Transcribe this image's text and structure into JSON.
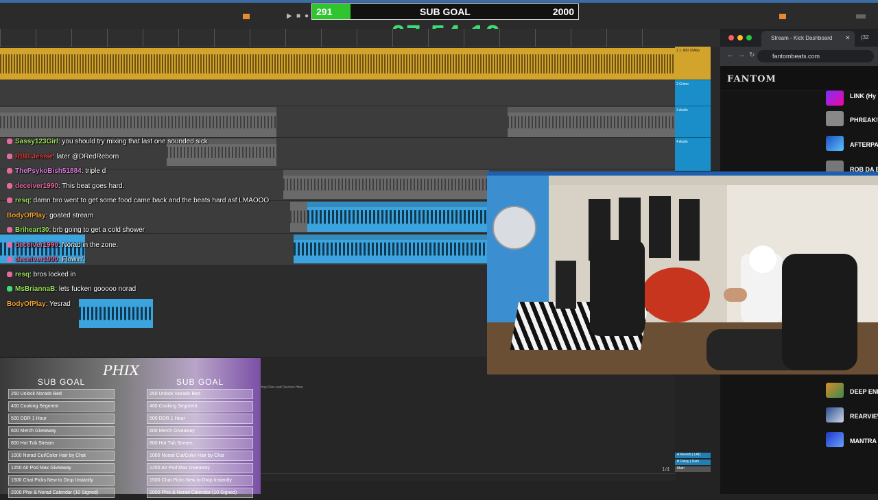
{
  "overlay": {
    "sub_goal": {
      "current": "291",
      "title": "SUB GOAL",
      "target": "2000",
      "progress": 0.1455
    },
    "timer": "07:54:19"
  },
  "colors": {
    "timer": "#3fdc74",
    "goal_fill": "#2fc52f",
    "clip_yellow": "#d3a42b",
    "clip_blue": "#3ba3de"
  },
  "daw": {
    "track_headers": [
      "1 1. 800 16Abp",
      "2 Grimo",
      "3 Audio",
      "4 Audio"
    ],
    "drop_text": "Drop Files and Devices Here",
    "return_tracks": [
      "A Reverb | LAD",
      "B Delay | Dark",
      "Main"
    ],
    "page_indicator": "1/4"
  },
  "chat": [
    {
      "user": "Sassy123Girl",
      "color": "#9be15d",
      "text": ": you should try mixing that last one sounded sick",
      "badge": "#e66aa0"
    },
    {
      "user": "RBB.Jessie",
      "color": "#e0403f",
      "text": ": later @DRedReborn",
      "badge": "#e66aa0"
    },
    {
      "user": "ThePsykoBish51884",
      "color": "#d67ad6",
      "text": ": triple d",
      "badge": "#e66aa0"
    },
    {
      "user": "deceiver1990",
      "color": "#e66aa0",
      "text": ": This beat goes hard.",
      "badge": "#e66aa0"
    },
    {
      "user": "resq",
      "color": "#9be15d",
      "text": ": damn bro went to get some food came back and the beats hard asf LMAOOO",
      "badge": "#e66aa0"
    },
    {
      "user": "BodyOfPlay",
      "color": "#f0a437",
      "text": ": goated stream",
      "badge": ""
    },
    {
      "user": "Briheart30",
      "color": "#9be15d",
      "text": ": brb going to get a cold shower",
      "badge": "#e66aa0"
    },
    {
      "user": "deceiver1990",
      "color": "#e66aa0",
      "text": ": Norad in the zone.",
      "badge": "#e66aa0"
    },
    {
      "user": "deceiver1990",
      "color": "#e66aa0",
      "text": ": Flowin'.",
      "badge": "#e66aa0"
    },
    {
      "user": "resq",
      "color": "#9be15d",
      "text": ": bros locked in",
      "badge": "#e66aa0"
    },
    {
      "user": "MsBriannaB",
      "color": "#9be15d",
      "text": ": lets fucken gooooo norad",
      "badge": "#3fdc74"
    },
    {
      "user": "BodyOfPlay",
      "color": "#f0a437",
      "text": ": Yesrad",
      "badge": ""
    }
  ],
  "sub_goals": {
    "logo": "PHIX",
    "heading": "SUB GOAL",
    "items": [
      "250 Unlock Norads Bed",
      "400 Cooking Segment",
      "500 DDR 1 Hour",
      "600 Merch Giveaway",
      "800 Hot Tub Stream",
      "1000 Norad Cut/Color Hair by Chat",
      "1250 Air Pod Max Giveaway",
      "1500 Chat Picks New to Drop Instantly",
      "2000 Phix & Norad Calendar (10 Signed)"
    ]
  },
  "browser": {
    "tab_title": "Stream - Kick Dashboard",
    "tab2": "(32",
    "url": "fantombeats.com",
    "site_logo": "FANTOM",
    "tracks_top": [
      "LINK (Hy",
      "PHREAK!",
      "AFTERPA",
      "ROB DA B"
    ],
    "tracks_bottom": [
      "DEEP END",
      "REARVIEW",
      "MANTRA"
    ]
  }
}
